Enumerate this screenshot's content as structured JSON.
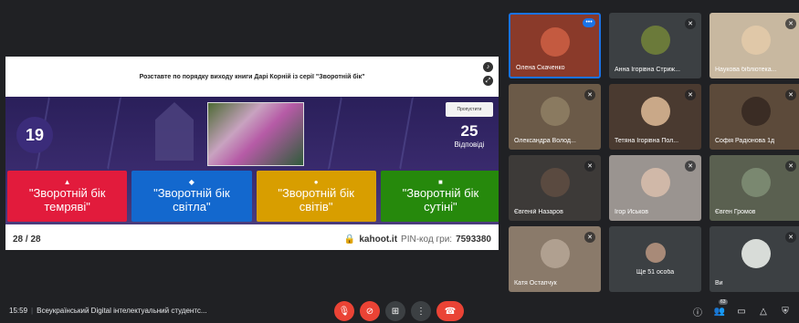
{
  "presentation": {
    "question": "Розставте по порядку виходу книги Дарі Корній із серії \"Зворотній бік\"",
    "timer": "19",
    "skip_label": "Пропустити",
    "answers_count": "25",
    "answers_label": "Відповіді",
    "answers": [
      {
        "shape": "▲",
        "label": "\"Зворотній бік темряві\""
      },
      {
        "shape": "◆",
        "label": "\"Зворотній бік світла\""
      },
      {
        "shape": "●",
        "label": "\"Зворотній бік світів\""
      },
      {
        "shape": "■",
        "label": "\"Зворотній бік сутіні\""
      }
    ],
    "progress": "28 / 28",
    "site": "kahoot.it",
    "pin_label": "PIN-код гри:",
    "pin": "7593380"
  },
  "participants": [
    {
      "name": "Олена Скаченко",
      "bg": "#8a3a2a"
    },
    {
      "name": "Анна Ігорівна Стриж...",
      "bg": "#3c4043"
    },
    {
      "name": "Наукова бібліотека...",
      "bg": "#c8b8a0"
    },
    {
      "name": "Олександра Волод...",
      "bg": "#6b5a48"
    },
    {
      "name": "Тетяна Ігорівна Пол...",
      "bg": "#4a3a30"
    },
    {
      "name": "Софія Радіонова 1д",
      "bg": "#5c4a3a"
    },
    {
      "name": "Євгеній Назаров",
      "bg": "#3d3a38"
    },
    {
      "name": "Ігор Иськов",
      "bg": "#9a9490"
    },
    {
      "name": "Євген Громов",
      "bg": "#5a6050"
    },
    {
      "name": "Катя Остапчук",
      "bg": "#8a7a6a"
    },
    {
      "name": "Ще 51 особа",
      "bg": "#3c4043"
    },
    {
      "name": "Ви",
      "bg": "#3c4043"
    }
  ],
  "bottombar": {
    "time": "15:59",
    "meeting_title": "Всеукраїнський Digital інтелектуальний студентс...",
    "participants_count": "63"
  }
}
